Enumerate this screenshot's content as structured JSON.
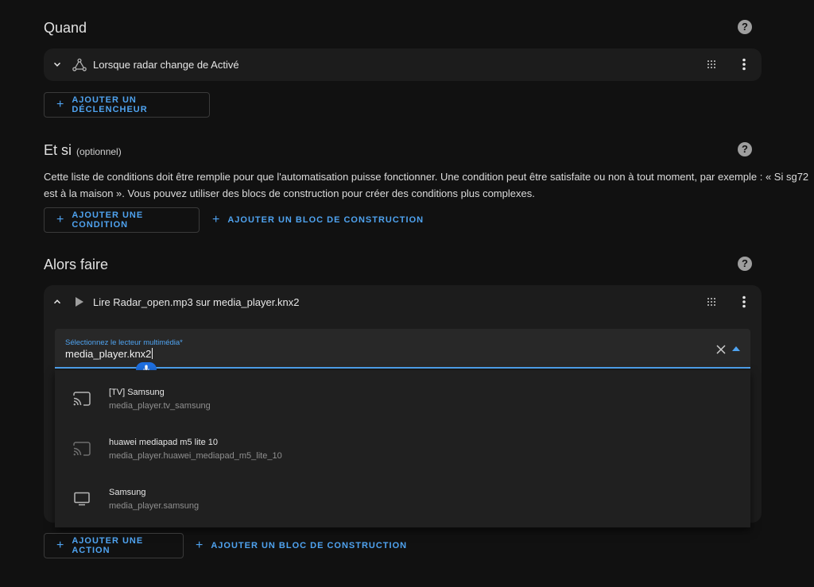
{
  "when": {
    "title": "Quand",
    "trigger_text": "Lorsque radar change de Activé",
    "add_trigger_label": "AJOUTER UN DÉCLENCHEUR"
  },
  "conditions": {
    "title": "Et si",
    "optional": "(optionnel)",
    "description_line1": "Cette liste de conditions doit être remplie pour que l'automatisation puisse fonctionner. Une condition peut être satisfaite ou non à tout moment, par exemple : « Si sg72",
    "description_line2": "est à la maison ». Vous pouvez utiliser des blocs de construction pour créer des conditions plus complexes.",
    "add_condition_label": "AJOUTER UNE CONDITION",
    "add_building_block_label": "AJOUTER UN BLOC DE CONSTRUCTION"
  },
  "actions": {
    "title": "Alors faire",
    "action_text": "Lire Radar_open.mp3 sur media_player.knx2",
    "field_label": "Sélectionnez le lecteur multimédia*",
    "field_value": "media_player.knx2",
    "options": [
      {
        "name": "[TV] Samsung",
        "id": "media_player.tv_samsung",
        "icon": "cast-icon"
      },
      {
        "name": "huawei mediapad m5 lite 10",
        "id": "media_player.huawei_mediapad_m5_lite_10",
        "icon": "cast-icon"
      },
      {
        "name": "Samsung",
        "id": "media_player.samsung",
        "icon": "monitor-icon"
      }
    ],
    "add_action_label": "AJOUTER UNE ACTION",
    "add_building_block_label": "AJOUTER UN BLOC DE CONSTRUCTION"
  },
  "colors": {
    "background": "#111111",
    "card": "#1c1c1c",
    "accent": "#4fa3f0",
    "mic": "#1e6fe0"
  }
}
